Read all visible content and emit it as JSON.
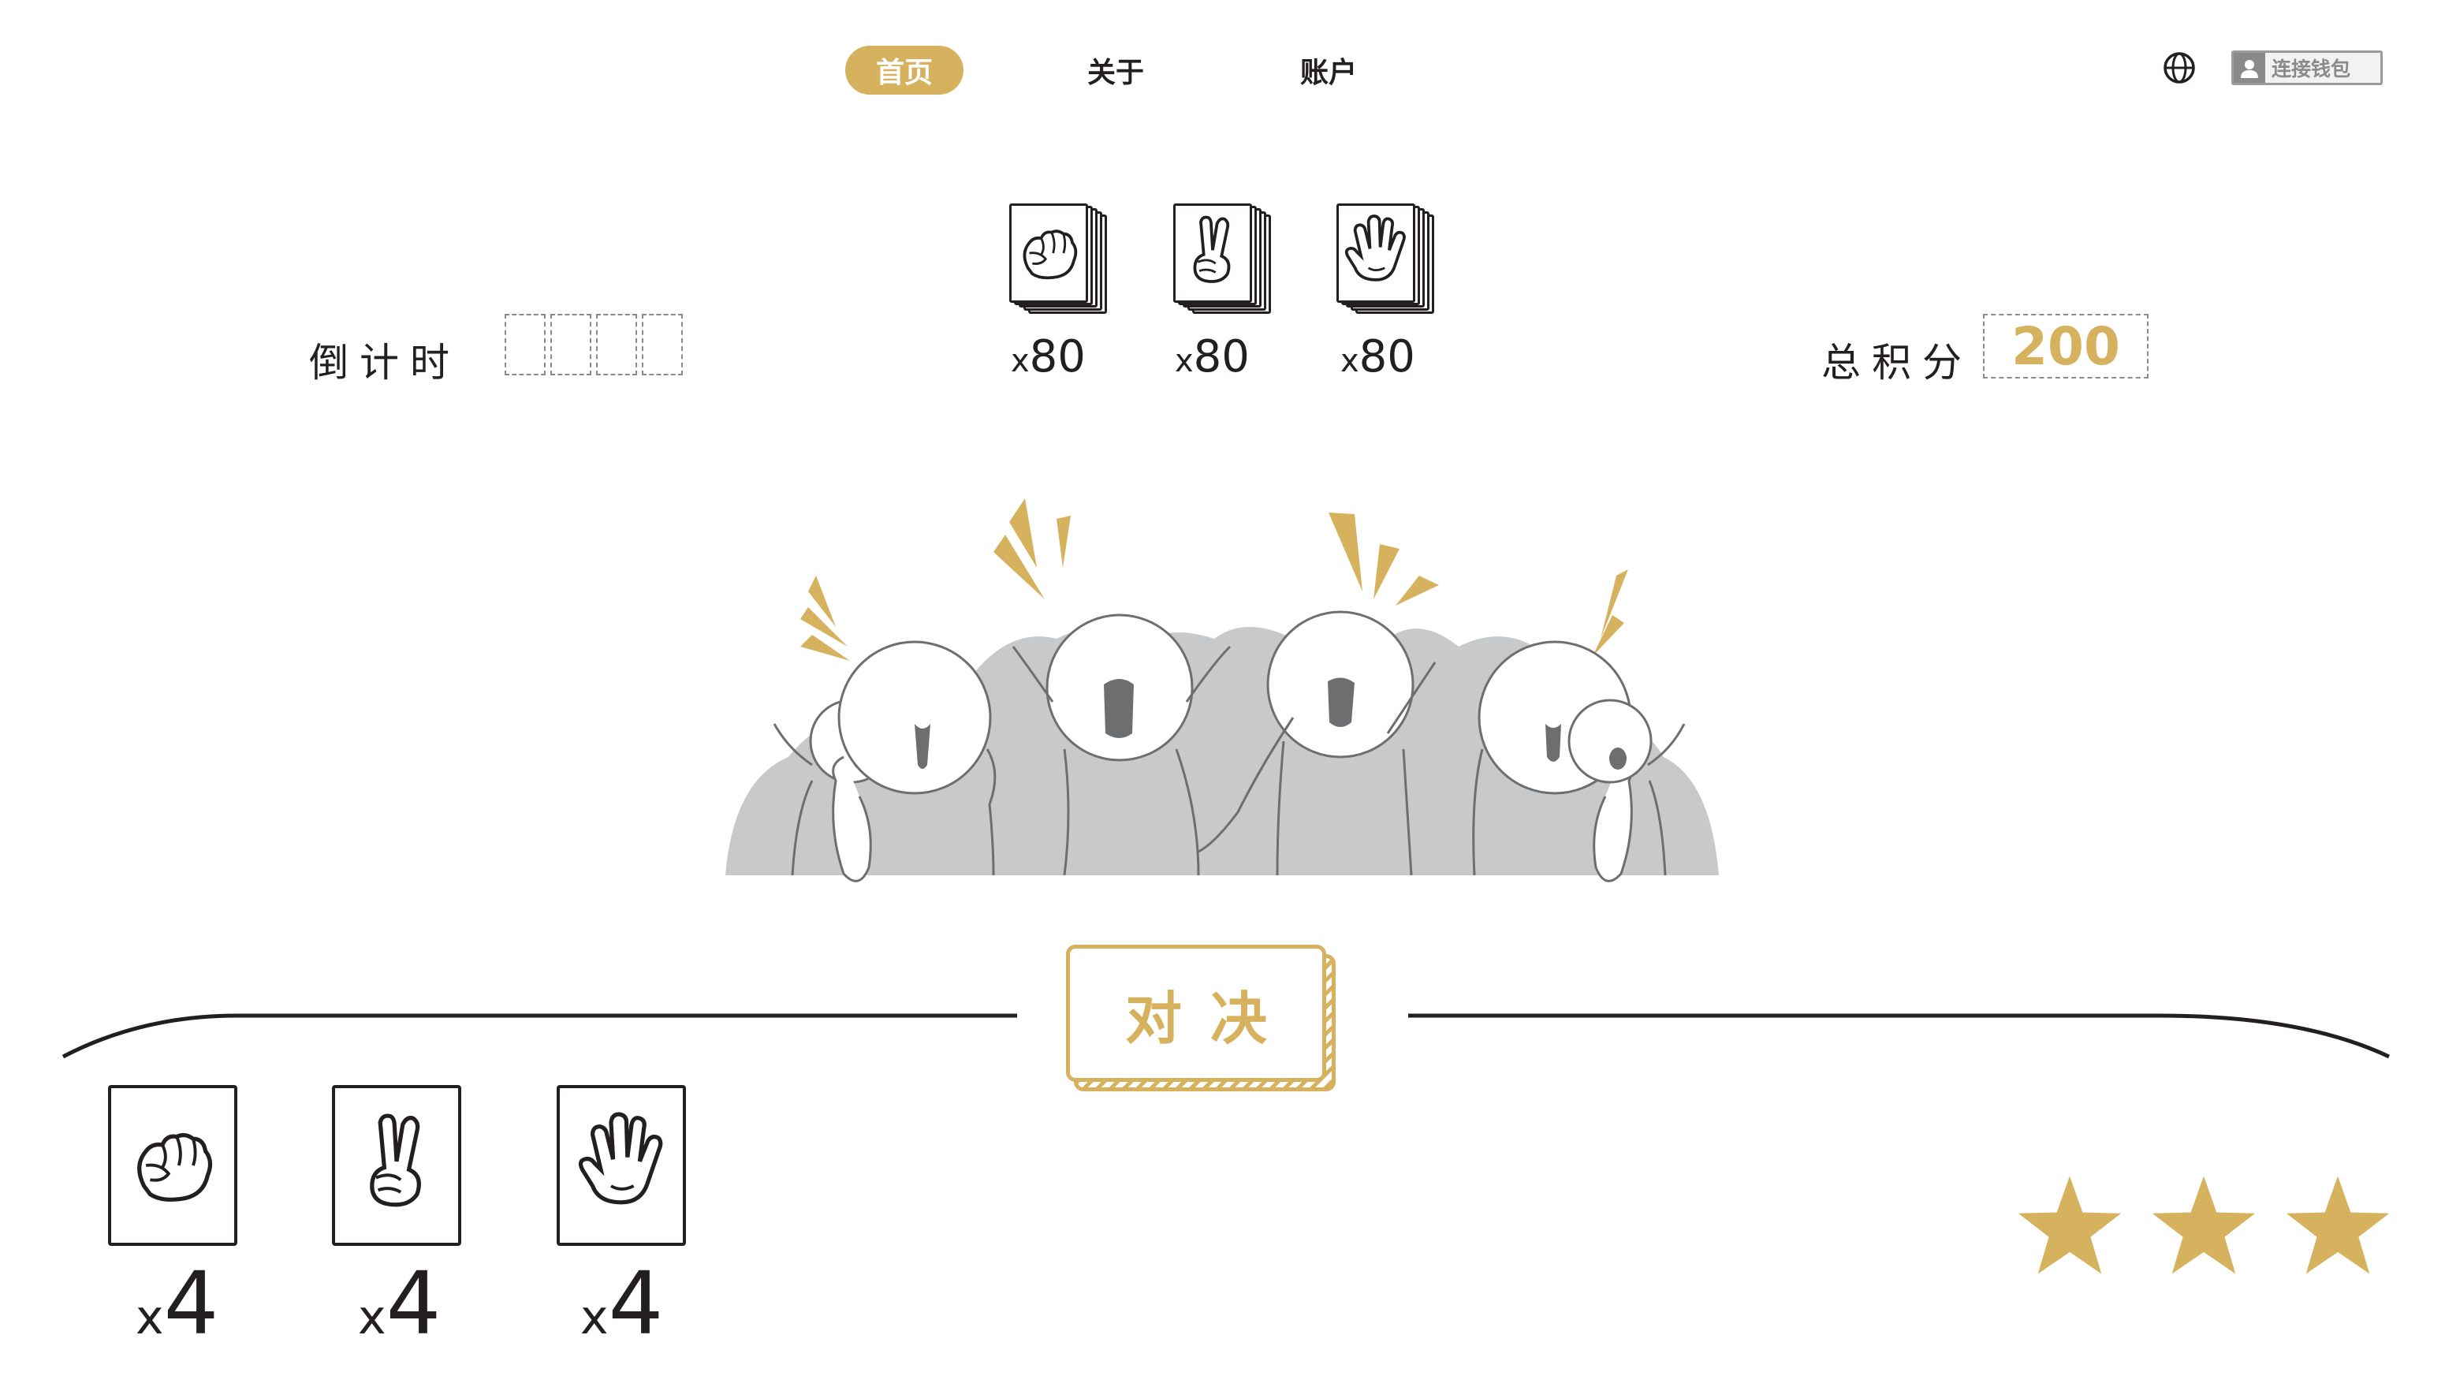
{
  "nav": {
    "items": [
      {
        "label": "首页",
        "active": true
      },
      {
        "label": "关于",
        "active": false
      },
      {
        "label": "账户",
        "active": false
      }
    ],
    "language_icon": "globe-icon",
    "wallet_button": {
      "icon": "user-icon",
      "label": "连接钱包"
    }
  },
  "countdown": {
    "label": "倒计时",
    "digits": [
      "",
      "",
      "",
      ""
    ]
  },
  "deck": [
    {
      "gesture": "rock",
      "icon": "fist-icon",
      "count_prefix": "x",
      "count": "80"
    },
    {
      "gesture": "scissors",
      "icon": "peace-sign-icon",
      "count_prefix": "x",
      "count": "80"
    },
    {
      "gesture": "paper",
      "icon": "open-palm-icon",
      "count_prefix": "x",
      "count": "80"
    }
  ],
  "score": {
    "label": "总积分",
    "value": "200"
  },
  "duel_button": {
    "label": "对决"
  },
  "hand": [
    {
      "gesture": "rock",
      "icon": "fist-icon",
      "count_prefix": "x",
      "count": "4"
    },
    {
      "gesture": "scissors",
      "icon": "peace-sign-icon",
      "count_prefix": "x",
      "count": "4"
    },
    {
      "gesture": "paper",
      "icon": "open-palm-icon",
      "count_prefix": "x",
      "count": "4"
    }
  ],
  "stars": {
    "filled": 3,
    "total": 3
  },
  "colors": {
    "accent": "#d6b15e",
    "text": "#231f20",
    "crowd_bg": "#c8c9ca",
    "mouth": "#6d6e70"
  }
}
